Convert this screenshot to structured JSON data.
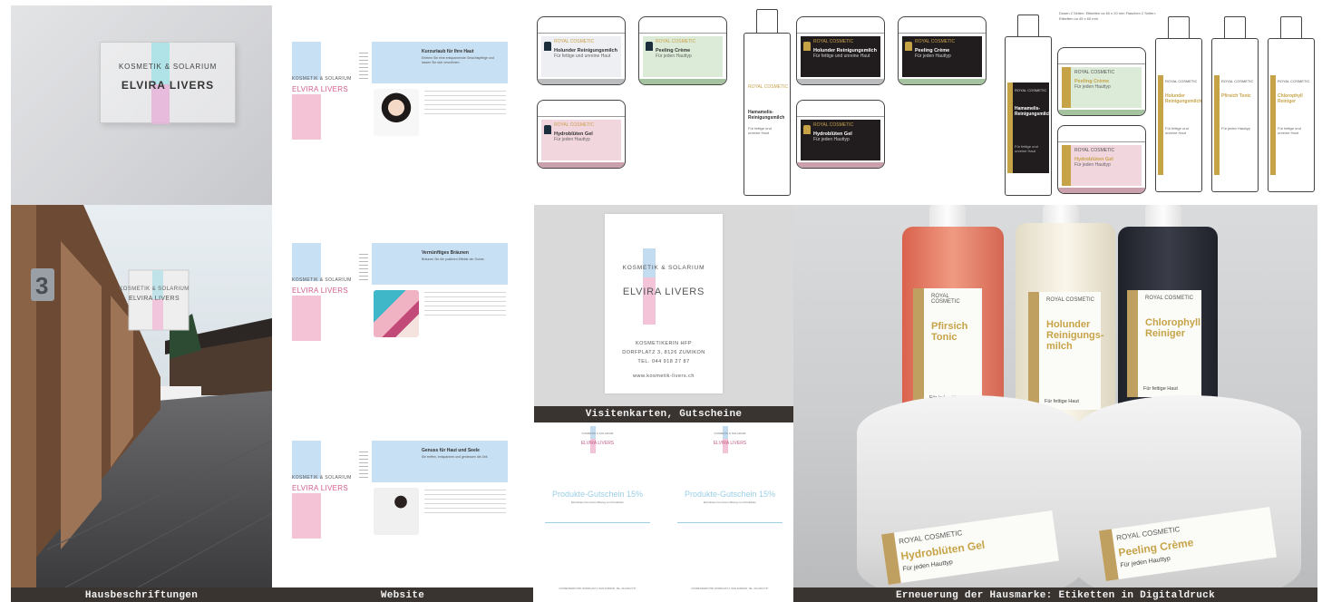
{
  "captions": {
    "house": "Hausbeschriftungen",
    "website": "Website",
    "cards": "Visitenkarten, Gutscheine",
    "labels": "Erneuerung der Hausmarke: Etiketten in Digitaldruck"
  },
  "brand": {
    "line1": "KOSMETIK & SOLARIUM",
    "line2": "ELVIRA LIVERS",
    "house_number": "3"
  },
  "website": {
    "pages": [
      {
        "title": "Kurzurlaub für Ihre Haut",
        "text": "Erleben Sie eine entspannende Gesichtspflege und lassen Sie sich verwöhnen."
      },
      {
        "title": "Vernünftiges Bräunen",
        "text": "Bräunen Sie die positiven Effekte der Sonne."
      },
      {
        "title": "Genuss für Haut und Seele",
        "text": "Sie treffen, entspannen und geniessen die Zeit."
      }
    ]
  },
  "card": {
    "name": "KOSMETIKERIN HFP",
    "address": "DORFPLATZ 3, 8126 ZUMIKON",
    "phone": "TEL. 044 918 27 87",
    "web": "www.kosmetik-livers.ch"
  },
  "voucher": {
    "title": "Produkte-Gutschein 15%",
    "sub": "Einzulösen bei einem Bezug von Produkten",
    "footer": "KOSMETIKERIN HFP, DORFPLATZ 3, 8126 ZUMIKON, TEL. 044 918 27 87"
  },
  "labels": {
    "brand": "ROYAL COSMETIC",
    "note": "Dosen 2 Seiten: Etiketten ca 60 x 20 mm  Flaschen 2 Seiten: Etiketten ca 45 x 60 mm",
    "items": [
      {
        "name": "Holunder Reinigungsmilch",
        "sub": "Für fettige und unreine Haut"
      },
      {
        "name": "Peeling Crème",
        "sub": "Für jeden Hauttyp"
      },
      {
        "name": "Hydroblüten Gel",
        "sub": "Für jeden Hauttyp"
      },
      {
        "name": "Hamamelis-Reinigungsmilch",
        "sub": "Für fettige und unreine Haut"
      },
      {
        "name": "Pfirsich Tonic",
        "sub": "Für jeden Hauttyp"
      },
      {
        "name": "Chlorophyll Reiniger",
        "sub": "Für fettige und unreine Haut"
      }
    ]
  },
  "products": {
    "bottles": [
      {
        "name": "Pfirsich Tonic",
        "sub": "Für jeden Hauttyp",
        "color": "#e9816d"
      },
      {
        "name": "Holunder Reinigungs-milch",
        "sub": "Für fettige Haut",
        "color": "#eee9d9"
      },
      {
        "name": "Chlorophyll Reiniger",
        "sub": "Für fettige Haut",
        "color": "#2c2e38"
      }
    ],
    "jars": [
      {
        "name": "Hydroblüten Gel",
        "sub": "Für jeden Hauttyp"
      },
      {
        "name": "Peeling Crème",
        "sub": "Für jeden Hauttyp"
      }
    ]
  }
}
